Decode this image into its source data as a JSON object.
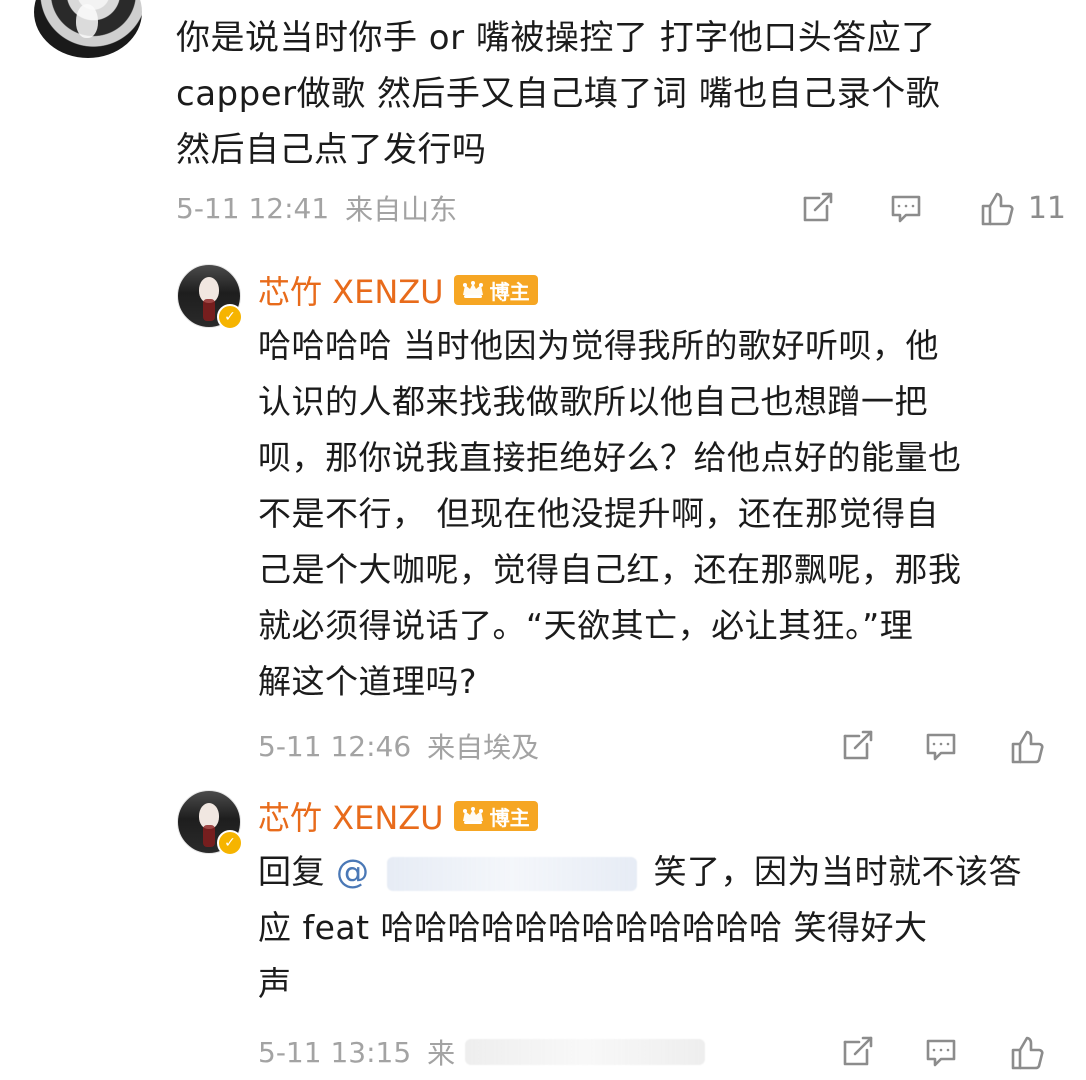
{
  "top_comment": {
    "lines": [
      "你是说当时你手 or 嘴被操控了 打字他口头答应了",
      "capper做歌 然后手又自己填了词 嘴也自己录个歌",
      "然后自己点了发行吗"
    ],
    "time": "5-11 12:41",
    "location": "来自山东",
    "like_count": "11"
  },
  "reply_1": {
    "name": "芯竹 XENZU",
    "badge": "博主",
    "lines": [
      "哈哈哈哈 当时他因为觉得我所的歌好听呗，他",
      "认识的人都来找我做歌所以他自己也想蹭一把",
      "呗，那你说我直接拒绝好么？给他点好的能量也",
      "不是不行， 但现在他没提升啊，还在那觉得自",
      "己是个大咖呢，觉得自己红，还在那飘呢，那我",
      "就必须得说话了。“天欲其亡，必让其狂。”理",
      "解这个道理吗?"
    ],
    "time": "5-11 12:46",
    "location": "来自埃及"
  },
  "reply_2": {
    "name": "芯竹 XENZU",
    "badge": "博主",
    "line1_prefix": "回复",
    "mention_prefix": "@",
    "line1_suffix": "笑了，因为当时就不该答",
    "line2": "应 feat 哈哈哈哈哈哈哈哈哈哈哈哈 笑得好大",
    "line3": "声",
    "time": "5-11 13:15",
    "location_prefix": "来"
  },
  "icons": {
    "share": "share-icon",
    "comment": "comment-icon",
    "like": "like-icon"
  },
  "colors": {
    "name": "#e86b1b",
    "meta": "#a3a3a3",
    "icon": "#8c8c8c",
    "badge": "#f6a623",
    "mention": "#4a78b6"
  }
}
